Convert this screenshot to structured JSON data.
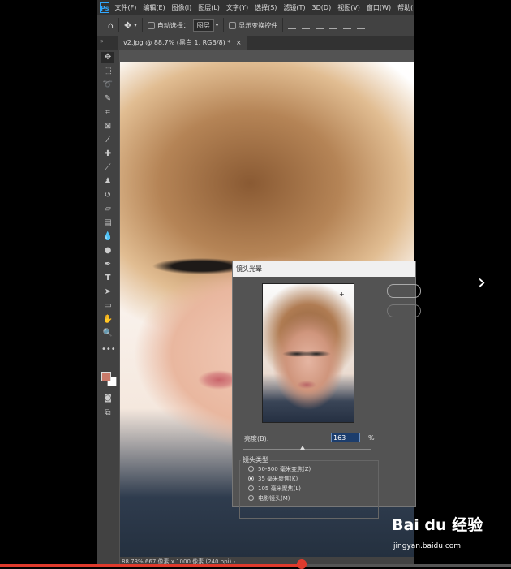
{
  "menubar": {
    "logo": "Ps",
    "items": [
      "文件(F)",
      "编辑(E)",
      "图像(I)",
      "图层(L)",
      "文字(Y)",
      "选择(S)",
      "滤镜(T)",
      "3D(D)",
      "视图(V)",
      "窗口(W)",
      "帮助(H)"
    ]
  },
  "options": {
    "auto_select_label": "自动选择：",
    "layer_select_value": "图层",
    "transform_label": "显示变换控件"
  },
  "document": {
    "tab_label": "v2.jpg @ 88.7% (黑白 1, RGB/8) *",
    "close_glyph": "×"
  },
  "statusbar": {
    "text": "88.73%   667 像素 x 1000 像素 (240 ppi)   ›"
  },
  "dialog": {
    "title": "镜头光晕",
    "brightness_label": "亮度(B):",
    "brightness_value": "163",
    "brightness_unit": "%",
    "brightness_slider_fraction": 0.47,
    "lens_type_title": "镜头类型",
    "lens_options": [
      "50-300 毫米变焦(Z)",
      "35 毫米聚焦(K)",
      "105 毫米聚焦(L)",
      "电影镜头(M)"
    ],
    "selected_lens_index": 1,
    "flare_marker": "+"
  },
  "colors": {
    "foreground": "#c97a6a",
    "background": "#ffffff",
    "accent": "#31a8ff"
  },
  "video": {
    "progress_fraction": 0.59,
    "next_glyph": "›"
  },
  "watermark": {
    "logo": "Bai du 经验",
    "url": "jingyan.baidu.com"
  }
}
